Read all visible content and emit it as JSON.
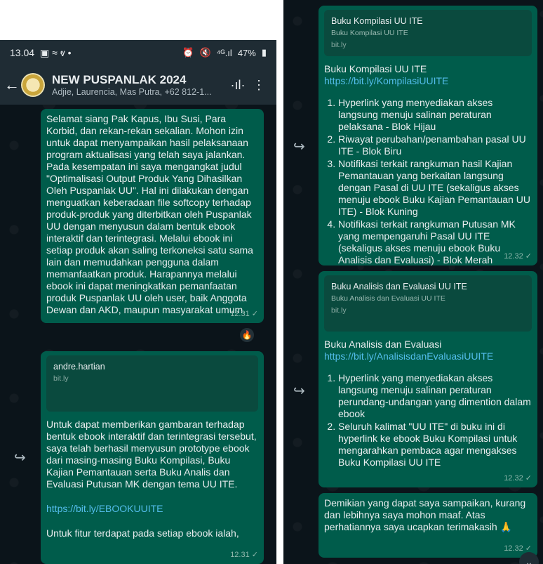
{
  "left": {
    "status": {
      "time": "13.04",
      "battery": "47%"
    },
    "header": {
      "title": "NEW PUSPANLAK 2024",
      "subtitle": "Adjie, Laurencia, Mas Putra, +62 812-1..."
    },
    "message1": {
      "text": "Selamat siang Pak Kapus, Ibu Susi, Para Korbid, dan rekan-rekan sekalian. Mohon izin untuk dapat menyampaikan hasil pelaksanaan program aktualisasi yang telah saya jalankan. Pada kesempatan ini saya mengangkat judul \"Optimalisasi Output Produk Yang Dihasilkan Oleh Puspanlak UU\". Hal ini dilakukan dengan menguatkan keberadaan file softcopy terhadap produk-produk yang diterbitkan oleh Puspanlak UU dengan menyusun dalam bentuk ebook interaktif dan terintegrasi. Melalui ebook ini setiap produk akan saling terkoneksi satu sama lain dan memudahkan pengguna dalam memanfaatkan produk. Harapannya melalui ebook ini dapat meningkatkan pemanfaatan produk Puspanlak UU oleh user, baik Anggota Dewan dan AKD, maupun masyarakat umum.",
      "time": "12.31",
      "reaction": "🔥"
    },
    "message2": {
      "preview_title": "andre.hartian",
      "preview_site": "bit.ly",
      "text": "Untuk dapat memberikan gambaran terhadap bentuk ebook interaktif dan terintegrasi tersebut, saya telah berhasil menyusun prototype ebook dari masing-masing Buku Kompilasi, Buku Kajian Pemantauan serta Buku Analis dan Evaluasi Putusan MK dengan tema UU ITE.",
      "link": "https://bit.ly/EBOOKUUITE",
      "text2": "Untuk fitur terdapat pada setiap ebook ialah,",
      "time": "12.31"
    }
  },
  "right": {
    "message3": {
      "preview_title": "Buku Kompilasi UU ITE",
      "preview_desc": "Buku Kompilasi UU ITE",
      "preview_site": "bit.ly",
      "heading": "Buku Kompilasi UU ITE",
      "link": "https://bit.ly/KompilasiUUITE",
      "items": [
        "Hyperlink yang menyediakan akses langsung menuju salinan peraturan pelaksana  - Blok Hijau",
        "Riwayat perubahan/penambahan pasal UU ITE - Blok Biru",
        "Notifikasi terkait rangkuman hasil Kajian Pemantauan yang berkaitan langsung dengan Pasal di UU ITE (sekaligus akses menuju ebook Buku Kajian Pemantauan UU ITE) - Blok Kuning",
        "Notifikasi terkait rangkuman Putusan MK yang mempengaruhi Pasal UU ITE (sekaligus akses menuju ebook Buku Analisis dan Evaluasi) - Blok Merah"
      ],
      "time": "12.32"
    },
    "message4": {
      "preview_title": "Buku Analisis dan Evaluasi UU ITE",
      "preview_desc": "Buku Analisis dan Evaluasi UU ITE",
      "preview_site": "bit.ly",
      "heading": "Buku Analisis dan Evaluasi",
      "link": "https://bit.ly/AnalisisdanEvaluasiUUITE",
      "items": [
        "Hyperlink yang menyediakan akses langsung menuju salinan peraturan perundang-undangan yang dimention dalam ebook",
        "Seluruh kalimat \"UU ITE\" di buku ini di hyperlink ke ebook Buku Kompilasi untuk mengarahkan pembaca agar mengakses Buku Kompilasi UU ITE"
      ],
      "time": "12.32"
    },
    "message5": {
      "text": "Demikian yang dapat saya sampaikan, kurang dan lebihnya saya mohon maaf. Atas perhatiannya saya ucapkan terimakasih 🙏",
      "time": "12.32"
    }
  }
}
